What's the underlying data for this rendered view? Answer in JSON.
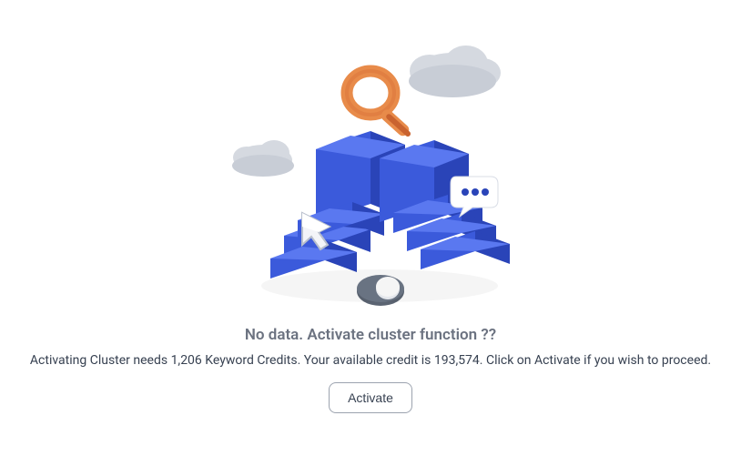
{
  "empty_state": {
    "heading": "No data. Activate cluster function ??",
    "description": "Activating Cluster needs 1,206 Keyword Credits. Your available credit is 193,574. Click on Activate if you wish to proceed.",
    "button_label": "Activate"
  }
}
